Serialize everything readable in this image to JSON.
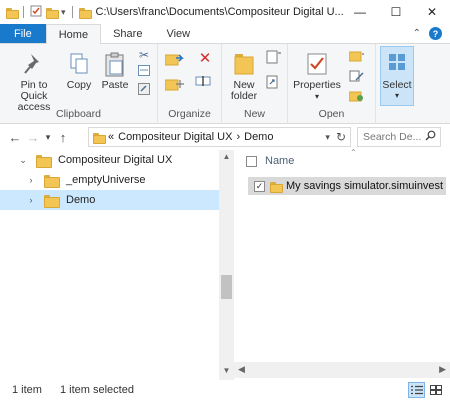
{
  "window": {
    "title": "C:\\Users\\franc\\Documents\\Compositeur Digital U...",
    "minimize": "—",
    "maximize": "☐",
    "close": "✕"
  },
  "tabs": [
    {
      "label": "File"
    },
    {
      "label": "Home"
    },
    {
      "label": "Share"
    },
    {
      "label": "View"
    }
  ],
  "ribbon": {
    "clipboard": {
      "label": "Clipboard",
      "pin_label_1": "Pin to Quick",
      "pin_label_2": "access",
      "copy_label": "Copy",
      "paste_label": "Paste"
    },
    "organize": {
      "label": "Organize"
    },
    "new": {
      "label": "New",
      "new_folder_1": "New",
      "new_folder_2": "folder"
    },
    "open": {
      "label": "Open",
      "properties_label": "Properties"
    },
    "select": {
      "label": "Select"
    }
  },
  "address": {
    "prefix": "«",
    "crumbs": [
      "Compositeur Digital UX",
      "Demo"
    ],
    "separator": "›",
    "search_placeholder": "Search De..."
  },
  "nav_tree": [
    {
      "label": "Compositeur Digital UX",
      "expanded": true
    },
    {
      "label": "_emptyUniverse",
      "expanded": false
    },
    {
      "label": "Demo",
      "expanded": false,
      "selected": true
    }
  ],
  "file_list": {
    "column_name": "Name",
    "items": [
      {
        "name": "My savings simulator.simuinvest",
        "checked": true
      }
    ]
  },
  "status": {
    "item_count": "1 item",
    "selected_count": "1 item selected"
  },
  "colors": {
    "accent": "#1979ca",
    "selection": "#cce8ff",
    "folder": "#f2c554"
  }
}
